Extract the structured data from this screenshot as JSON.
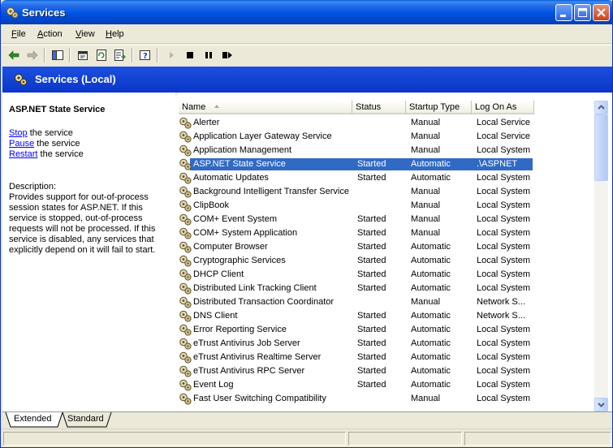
{
  "window": {
    "title": "Services",
    "icon": "services-gear-icon"
  },
  "menu": {
    "items": [
      {
        "label": "File",
        "accel": "F",
        "rest": "ile"
      },
      {
        "label": "Action",
        "accel": "A",
        "rest": "ction"
      },
      {
        "label": "View",
        "accel": "V",
        "rest": "iew"
      },
      {
        "label": "Help",
        "accel": "H",
        "rest": "elp"
      }
    ]
  },
  "header": {
    "title": "Services (Local)"
  },
  "left": {
    "service_title": "ASP.NET State Service",
    "actions": [
      {
        "link": "Stop",
        "rest": " the service"
      },
      {
        "link": "Pause",
        "rest": " the service"
      },
      {
        "link": "Restart",
        "rest": " the service"
      }
    ],
    "description_label": "Description:",
    "description": "Provides support for out-of-process session states for ASP.NET. If this service is stopped, out-of-process requests will not be processed. If this service is disabled, any services that explicitly depend on it will fail to start."
  },
  "list": {
    "columns": [
      "Name",
      "Status",
      "Startup Type",
      "Log On As"
    ],
    "selected_index": 3,
    "rows": [
      {
        "name": "Alerter",
        "status": "",
        "startup": "Manual",
        "logon": "Local Service"
      },
      {
        "name": "Application Layer Gateway Service",
        "status": "",
        "startup": "Manual",
        "logon": "Local Service"
      },
      {
        "name": "Application Management",
        "status": "",
        "startup": "Manual",
        "logon": "Local System"
      },
      {
        "name": "ASP.NET State Service",
        "status": "Started",
        "startup": "Automatic",
        "logon": ".\\ASPNET"
      },
      {
        "name": "Automatic Updates",
        "status": "Started",
        "startup": "Automatic",
        "logon": "Local System"
      },
      {
        "name": "Background Intelligent Transfer Service",
        "status": "",
        "startup": "Manual",
        "logon": "Local System"
      },
      {
        "name": "ClipBook",
        "status": "",
        "startup": "Manual",
        "logon": "Local System"
      },
      {
        "name": "COM+ Event System",
        "status": "Started",
        "startup": "Manual",
        "logon": "Local System"
      },
      {
        "name": "COM+ System Application",
        "status": "Started",
        "startup": "Manual",
        "logon": "Local System"
      },
      {
        "name": "Computer Browser",
        "status": "Started",
        "startup": "Automatic",
        "logon": "Local System"
      },
      {
        "name": "Cryptographic Services",
        "status": "Started",
        "startup": "Automatic",
        "logon": "Local System"
      },
      {
        "name": "DHCP Client",
        "status": "Started",
        "startup": "Automatic",
        "logon": "Local System"
      },
      {
        "name": "Distributed Link Tracking Client",
        "status": "Started",
        "startup": "Automatic",
        "logon": "Local System"
      },
      {
        "name": "Distributed Transaction Coordinator",
        "status": "",
        "startup": "Manual",
        "logon": "Network S..."
      },
      {
        "name": "DNS Client",
        "status": "Started",
        "startup": "Automatic",
        "logon": "Network S..."
      },
      {
        "name": "Error Reporting Service",
        "status": "Started",
        "startup": "Automatic",
        "logon": "Local System"
      },
      {
        "name": "eTrust Antivirus Job Server",
        "status": "Started",
        "startup": "Automatic",
        "logon": "Local System"
      },
      {
        "name": "eTrust Antivirus Realtime Server",
        "status": "Started",
        "startup": "Automatic",
        "logon": "Local System"
      },
      {
        "name": "eTrust Antivirus RPC Server",
        "status": "Started",
        "startup": "Automatic",
        "logon": "Local System"
      },
      {
        "name": "Event Log",
        "status": "Started",
        "startup": "Automatic",
        "logon": "Local System"
      },
      {
        "name": "Fast User Switching Compatibility",
        "status": "",
        "startup": "Manual",
        "logon": "Local System"
      }
    ]
  },
  "tabs": [
    "Extended",
    "Standard"
  ],
  "active_tab": 0
}
